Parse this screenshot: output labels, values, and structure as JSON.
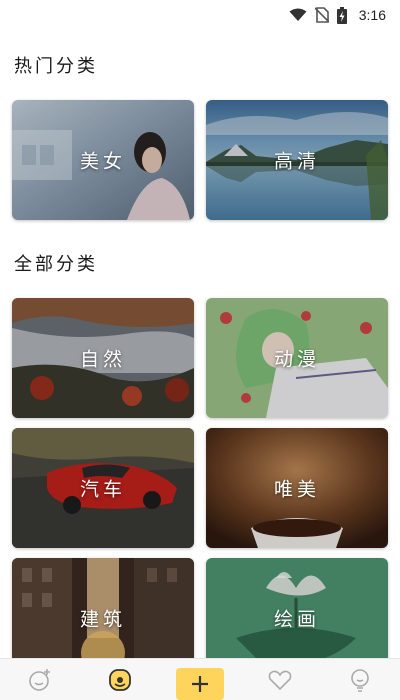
{
  "status_bar": {
    "time": "3:16",
    "icons": [
      "wifi-icon",
      "no-sim-icon",
      "battery-charging-icon"
    ]
  },
  "sections": {
    "hot": {
      "title": "热门分类",
      "items": [
        {
          "label": "美女",
          "image": "portrait-photo"
        },
        {
          "label": "高清",
          "image": "lake-mountain-photo"
        }
      ]
    },
    "all": {
      "title": "全部分类",
      "items": [
        {
          "label": "自然",
          "image": "misty-valley-photo"
        },
        {
          "label": "动漫",
          "image": "anime-girl-illustration"
        },
        {
          "label": "汽车",
          "image": "red-sports-car-photo"
        },
        {
          "label": "唯美",
          "image": "tea-bowl-photo"
        },
        {
          "label": "建筑",
          "image": "city-street-sunset-photo"
        },
        {
          "label": "绘画",
          "image": "lotus-painting"
        }
      ]
    }
  },
  "bottom_nav": {
    "items": [
      "add-face-icon",
      "smiley-icon",
      "add-icon",
      "heart-icon",
      "bulb-face-icon"
    ],
    "accent": "#ffd45c"
  }
}
